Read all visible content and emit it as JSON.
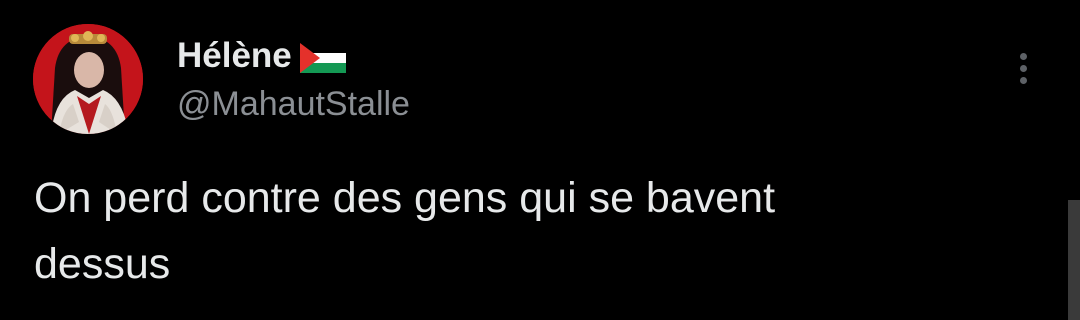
{
  "tweet": {
    "author": {
      "display_name": "Hélène",
      "flag_icon": "palestine-flag-icon",
      "handle": "@MahautStalle",
      "avatar_icon": "profile-avatar"
    },
    "text": "On perd contre des gens qui se bavent\ndessus",
    "more_icon": "more-vertical-icon"
  },
  "colors": {
    "background": "#000000",
    "primary_text": "#e7e9ea",
    "secondary_text": "#8b8f94",
    "avatar_bg": "#c4141b"
  }
}
